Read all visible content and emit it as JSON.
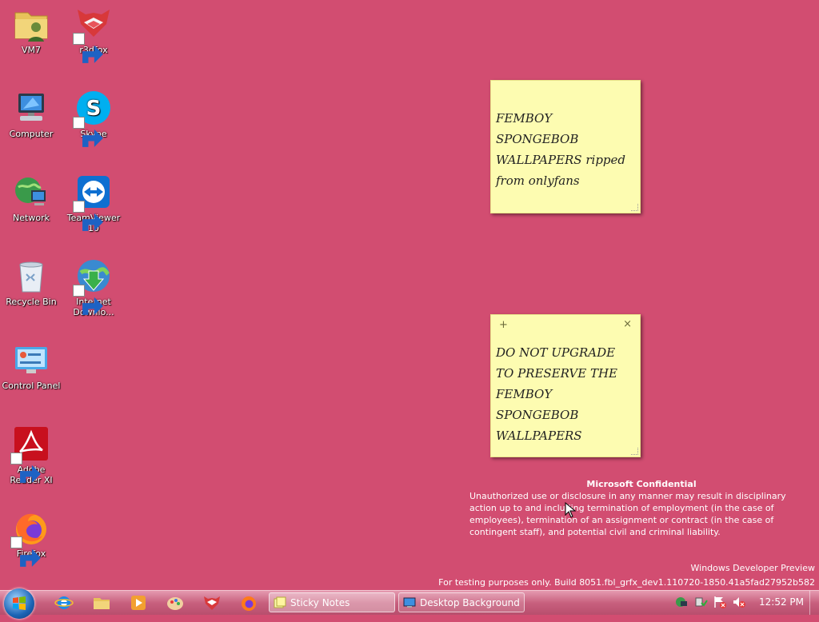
{
  "desktop": {
    "background_color": "#d24d71",
    "icons": [
      {
        "label": "VM7",
        "icon": "folder-user-icon"
      },
      {
        "label": "r3dfox",
        "icon": "r3dfox-icon"
      },
      {
        "label": "Computer",
        "icon": "computer-icon"
      },
      {
        "label": "Skype",
        "icon": "skype-icon"
      },
      {
        "label": "Network",
        "icon": "network-icon"
      },
      {
        "label": "TeamViewer 10",
        "icon": "teamviewer-icon"
      },
      {
        "label": "Recycle Bin",
        "icon": "recycle-bin-icon"
      },
      {
        "label": "Internet Downlo...",
        "icon": "internet-download-manager-icon"
      },
      {
        "label": "Control Panel",
        "icon": "control-panel-icon"
      },
      {
        "label": "Adobe Reader XI",
        "icon": "adobe-reader-icon"
      },
      {
        "label": "Firefox",
        "icon": "firefox-icon"
      }
    ]
  },
  "sticky_notes": [
    {
      "text": "FEMBOY SPONGEBOB WALLPAPERS ripped from onlyfans"
    },
    {
      "text": "DO NOT UPGRADE TO PRESERVE THE FEMBOY SPONGEBOB WALLPAPERS",
      "plus": "+",
      "close": "×"
    }
  ],
  "watermark": {
    "title": "Microsoft Confidential",
    "body": "Unauthorized use or disclosure in any manner may result in disciplinary action up to and including termination of employment (in the case of employees), termination of an assignment or contract (in the case of contingent staff), and potential civil and criminal liability.",
    "edition": "Windows Developer Preview",
    "build": "For testing purposes only. Build 8051.fbl_grfx_dev1.110720-1850.41a5fad27952b582"
  },
  "taskbar": {
    "pinned": [
      "internet-explorer-icon",
      "explorer-folder-icon",
      "media-player-icon",
      "paint-icon",
      "r3dfox-icon",
      "firefox-icon"
    ],
    "tasks": [
      {
        "label": "Sticky Notes",
        "icon": "sticky-notes-icon",
        "active": true
      },
      {
        "label": "Desktop Background",
        "icon": "desktop-background-icon",
        "active": false
      }
    ],
    "tray": [
      "network-tray-icon",
      "safely-remove-icon",
      "action-center-icon",
      "volume-muted-icon"
    ],
    "clock": "12:52 PM"
  }
}
